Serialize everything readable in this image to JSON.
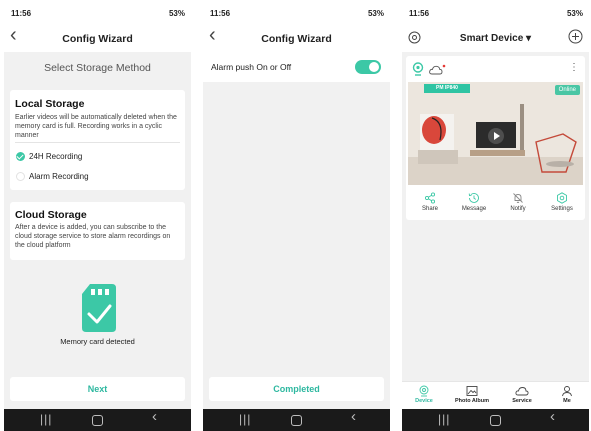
{
  "status": {
    "time": "11:56",
    "battery": "53%"
  },
  "screen1": {
    "nav_title": "Config Wizard",
    "heading": "Select Storage Method",
    "local": {
      "title": "Local Storage",
      "desc": "Earlier videos will be automatically deleted when the memory card is full. Recording works in a cyclic manner",
      "options": [
        {
          "label": "24H Recording",
          "selected": true
        },
        {
          "label": "Alarm Recording",
          "selected": false
        }
      ]
    },
    "cloud": {
      "title": "Cloud Storage",
      "desc": "After a device is added, you can subscribe to the cloud storage service to store alarm recordings on the cloud platform"
    },
    "sd_status": "Memory card detected",
    "button": "Next"
  },
  "screen2": {
    "nav_title": "Config Wizard",
    "alarm_label": "Alarm push On or Off",
    "alarm_on": true,
    "button": "Completed"
  },
  "screen3": {
    "nav_title": "Smart Device ▾",
    "device": {
      "model": "PM IP840",
      "status": "Online",
      "actions": [
        {
          "label": "Share",
          "icon": "share-icon"
        },
        {
          "label": "Message",
          "icon": "message-clock-icon"
        },
        {
          "label": "Notify",
          "icon": "notify-off-icon"
        },
        {
          "label": "Settings",
          "icon": "settings-icon"
        }
      ]
    },
    "tabs": [
      {
        "label": "Device",
        "icon": "device-icon",
        "active": true
      },
      {
        "label": "Photo Album",
        "icon": "photo-album-icon",
        "active": false
      },
      {
        "label": "Service",
        "icon": "service-cloud-icon",
        "active": false
      },
      {
        "label": "Me",
        "icon": "user-icon",
        "active": false
      }
    ]
  },
  "colors": {
    "accent": "#3cc8a6",
    "background": "#f1f1f1",
    "sysnav": "#1a1a1a"
  }
}
